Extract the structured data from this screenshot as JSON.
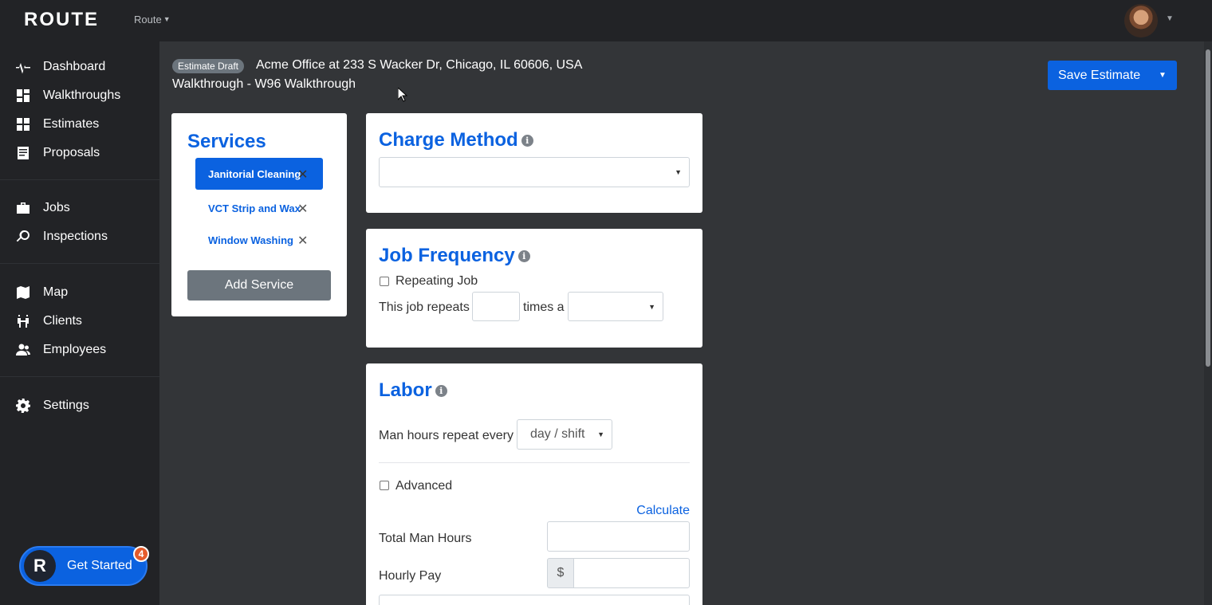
{
  "app": {
    "logo": "ROUTE",
    "switcher_label": "Route"
  },
  "sidebar": {
    "items": [
      {
        "label": "Dashboard",
        "icon": "pulse-icon"
      },
      {
        "label": "Walkthroughs",
        "icon": "walkthrough-icon"
      },
      {
        "label": "Estimates",
        "icon": "grid-icon"
      },
      {
        "label": "Proposals",
        "icon": "document-icon"
      },
      {
        "label": "Jobs",
        "icon": "briefcase-icon"
      },
      {
        "label": "Inspections",
        "icon": "magnifier-icon"
      },
      {
        "label": "Map",
        "icon": "map-icon"
      },
      {
        "label": "Clients",
        "icon": "clients-icon"
      },
      {
        "label": "Employees",
        "icon": "employees-icon"
      },
      {
        "label": "Settings",
        "icon": "gear-icon"
      }
    ],
    "get_started": {
      "label": "Get Started",
      "badge": "4",
      "logo_letter": "R"
    }
  },
  "header": {
    "badge": "Estimate Draft",
    "address": "Acme Office at 233 S Wacker Dr, Chicago, IL 60606, USA",
    "walkthrough": "Walkthrough - W96 Walkthrough",
    "save_label": "Save Estimate"
  },
  "services": {
    "title": "Services",
    "items": [
      {
        "name": "Janitorial Cleaning",
        "active": true
      },
      {
        "name": "VCT Strip and Wax",
        "active": false
      },
      {
        "name": "Window Washing",
        "active": false
      }
    ],
    "add_label": "Add Service",
    "remove_glyph": "✕"
  },
  "charge_method": {
    "title": "Charge Method",
    "selected": ""
  },
  "job_frequency": {
    "title": "Job Frequency",
    "repeating_label": "Repeating Job",
    "repeats_prefix": "This job repeats",
    "repeats_mid": "times a",
    "repeats_count": "",
    "repeats_period": ""
  },
  "labor": {
    "title": "Labor",
    "repeat_label": "Man hours repeat every",
    "repeat_value": "day / shift",
    "advanced_label": "Advanced",
    "calculate_label": "Calculate",
    "total_hours_label": "Total Man Hours",
    "hourly_pay_label": "Hourly Pay",
    "currency_symbol": "$"
  },
  "info_glyph": "i"
}
